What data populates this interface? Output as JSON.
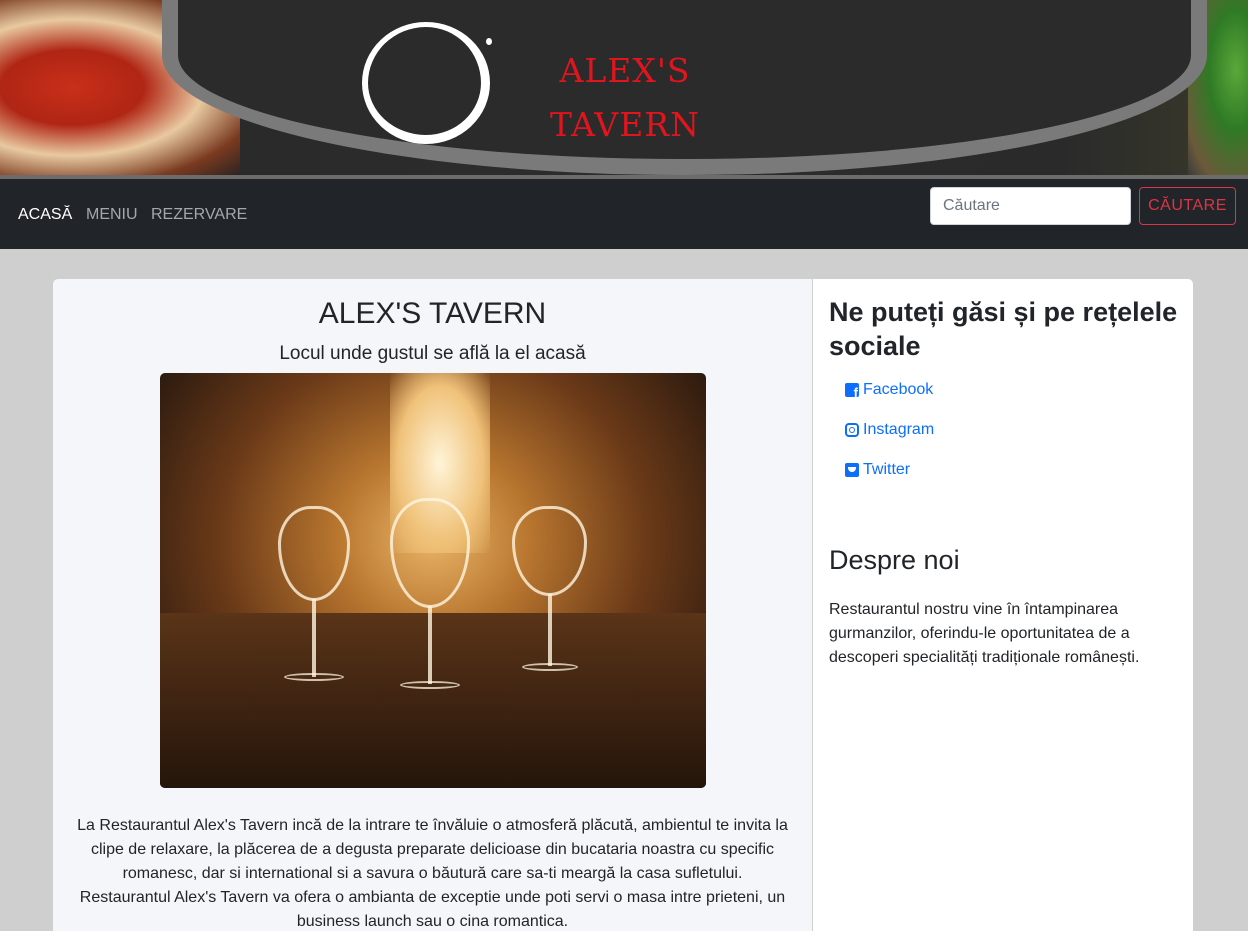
{
  "header": {
    "brand_line1": "ALEX'S",
    "brand_line2": "TAVERN"
  },
  "nav": {
    "items": [
      {
        "label": "ACASĂ",
        "active": true
      },
      {
        "label": "MENIU",
        "active": false
      },
      {
        "label": "REZERVARE",
        "active": false
      }
    ],
    "search_placeholder": "Căutare",
    "search_button": "CĂUTARE"
  },
  "main": {
    "title": "ALEX'S TAVERN",
    "subtitle": "Locul unde gustul se află la el acasă",
    "text_line1": "La Restaurantul Alex's Tavern incă de la intrare te învăluie o atmosferă plăcută, ambientul te invita la clipe de relaxare, la plăcerea de a degusta preparate delicioase din bucataria noastra cu specific romanesc, dar si international si a savura o băutură care sa-ti meargă la casa sufletului.",
    "text_line2": "Restaurantul Alex's Tavern va ofera o ambianta de exceptie unde poti servi o masa intre prieteni, un business launch sau o cina romantica."
  },
  "sidebar": {
    "social_heading": "Ne puteți găsi și pe rețelele sociale",
    "social_links": [
      {
        "label": "Facebook",
        "icon": "facebook-icon"
      },
      {
        "label": "Instagram",
        "icon": "instagram-icon"
      },
      {
        "label": "Twitter",
        "icon": "twitter-icon"
      }
    ],
    "about_title": "Despre noi",
    "about_text": "Restaurantul nostru vine în întampinarea gurmanzilor, oferindu-le oportunitatea de a descoperi specialități tradiționale românești."
  },
  "colors": {
    "brand_red": "#e0151d",
    "navbar_bg": "#212529",
    "link_blue": "#0d6efd",
    "danger": "#dc3545"
  }
}
